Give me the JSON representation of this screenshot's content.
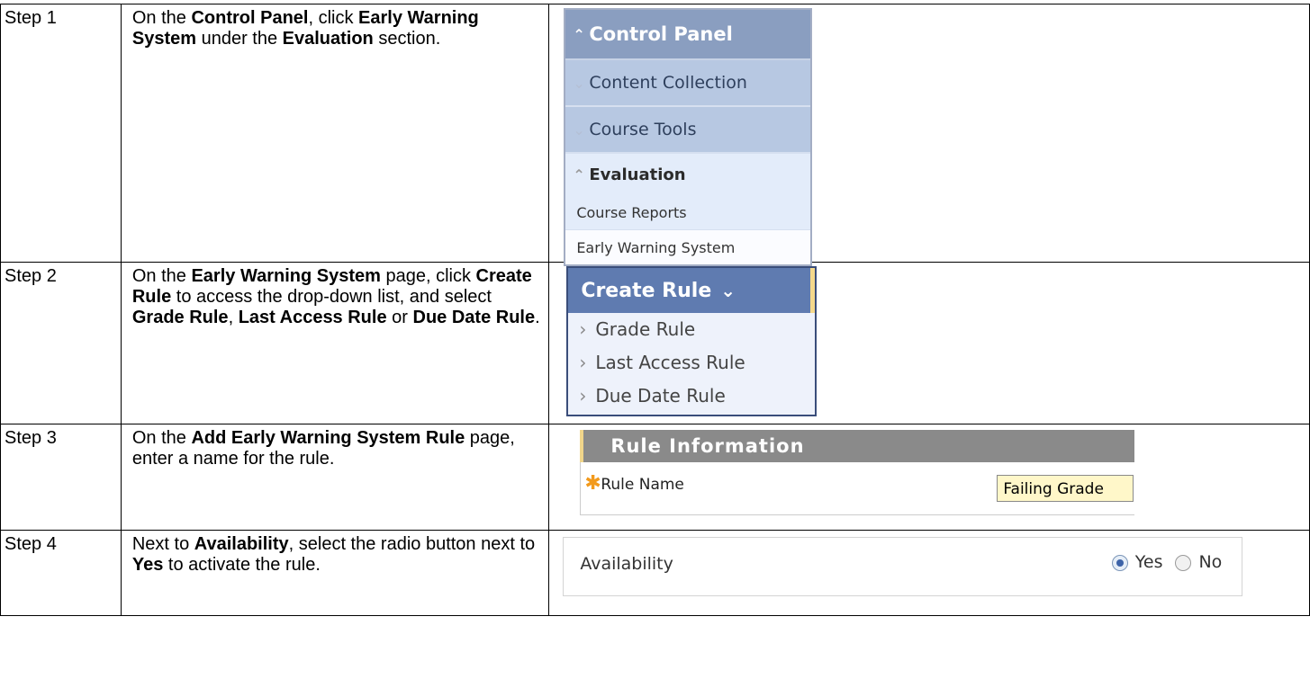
{
  "rows": [
    {
      "step": "Step 1",
      "desc": [
        {
          "t": "On the ",
          "b": false
        },
        {
          "t": "Control Panel",
          "b": true
        },
        {
          "t": ", click ",
          "b": false
        },
        {
          "t": "Early Warning System",
          "b": true
        },
        {
          "t": " under the ",
          "b": false
        },
        {
          "t": "Evaluation",
          "b": true
        },
        {
          "t": " section.",
          "b": false
        }
      ]
    },
    {
      "step": "Step 2",
      "desc": [
        {
          "t": "On the ",
          "b": false
        },
        {
          "t": "Early Warning System",
          "b": true
        },
        {
          "t": " page, click ",
          "b": false
        },
        {
          "t": "Create Rule",
          "b": true
        },
        {
          "t": " to access the drop-down list, and select ",
          "b": false
        },
        {
          "t": "Grade Rule",
          "b": true
        },
        {
          "t": ", ",
          "b": false
        },
        {
          "t": "Last Access Rule",
          "b": true
        },
        {
          "t": " or ",
          "b": false
        },
        {
          "t": "Due Date Rule",
          "b": true
        },
        {
          "t": ".",
          "b": false
        }
      ]
    },
    {
      "step": "Step 3",
      "desc": [
        {
          "t": "On the ",
          "b": false
        },
        {
          "t": "Add Early Warning System Rule",
          "b": true
        },
        {
          "t": " page, enter a name for the rule.",
          "b": false
        }
      ]
    },
    {
      "step": "Step 4",
      "desc": [
        {
          "t": "Next to ",
          "b": false
        },
        {
          "t": "Availability",
          "b": true
        },
        {
          "t": ", select the radio button next to ",
          "b": false
        },
        {
          "t": "Yes",
          "b": true
        },
        {
          "t": " to activate the rule.",
          "b": false
        }
      ]
    }
  ],
  "control_panel": {
    "header": "Control Panel",
    "items": [
      "Content Collection",
      "Course Tools"
    ],
    "section": "Evaluation",
    "links": [
      "Course Reports",
      "Early Warning System"
    ]
  },
  "create_rule": {
    "button": "Create Rule",
    "options": [
      "Grade Rule",
      "Last Access Rule",
      "Due Date Rule"
    ]
  },
  "rule_info": {
    "header": "Rule Information",
    "label": "Rule Name",
    "value": "Failing Grade"
  },
  "availability": {
    "label": "Availability",
    "yes": "Yes",
    "no": "No",
    "selected": "Yes"
  },
  "colors": {
    "cp_header": "#8a9ec0",
    "cr_header": "#5f7bb0",
    "ri_header": "#8a8a8a",
    "required_star": "#f29a1c",
    "input_highlight": "#fff7c9"
  }
}
